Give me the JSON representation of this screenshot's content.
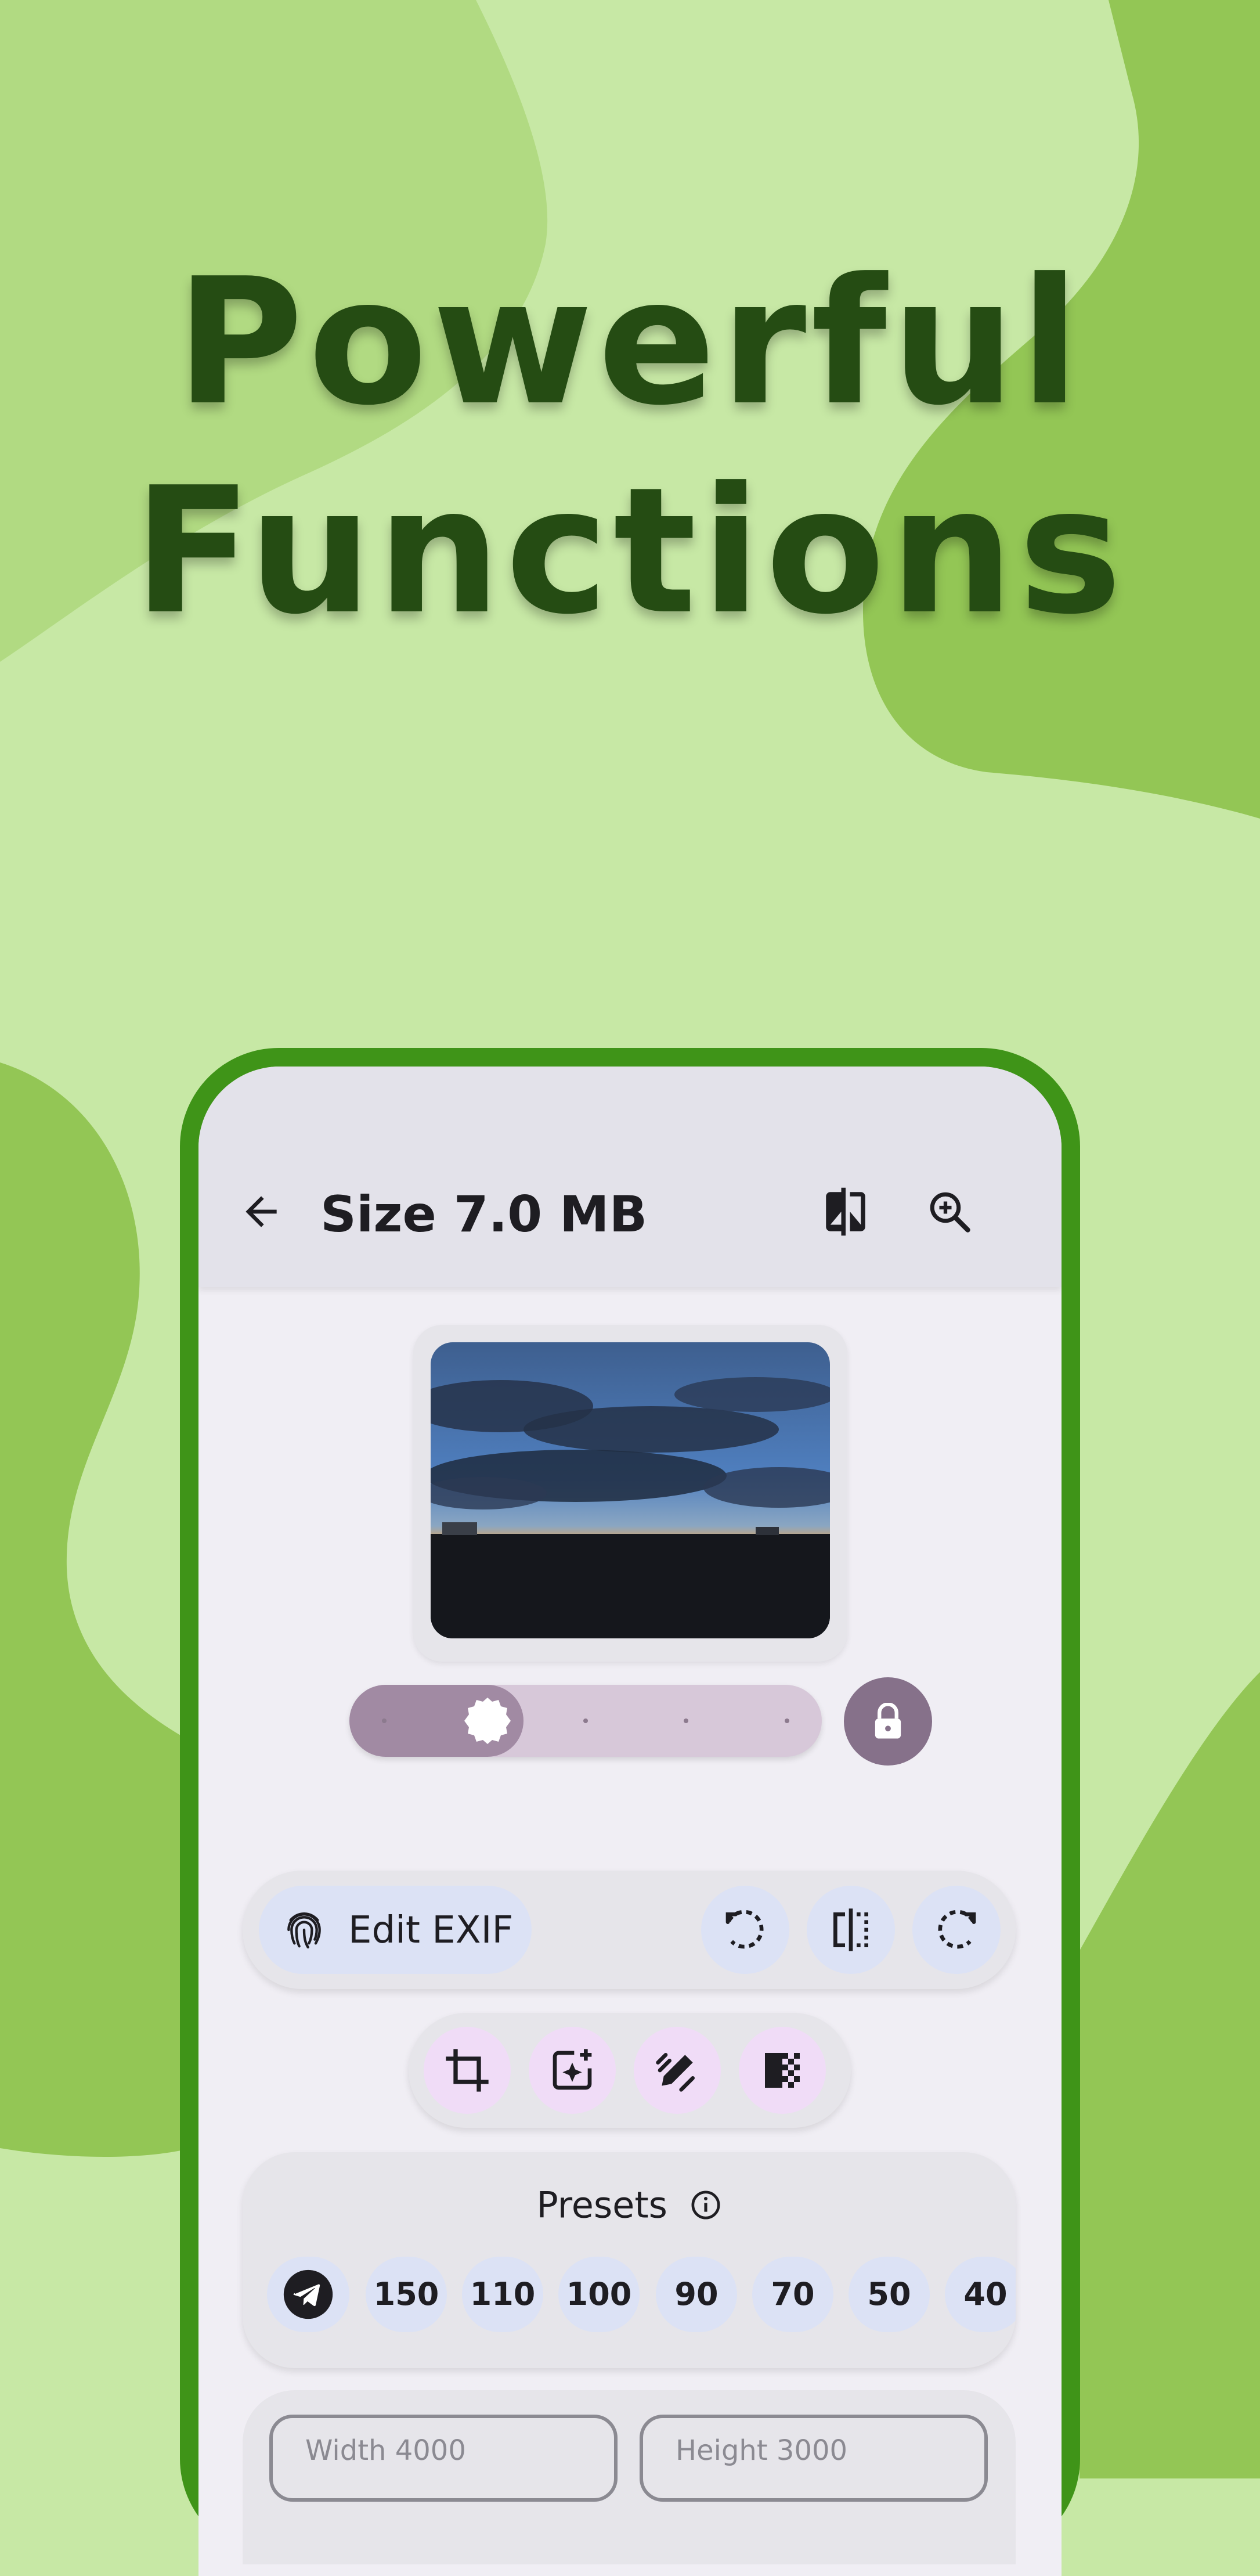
{
  "headline": {
    "line1": "Powerful",
    "line2": "Functions"
  },
  "app_bar": {
    "title": "Size 7.0 MB",
    "back_icon": "arrow-back-icon",
    "compare_icon": "compare-icon",
    "zoom_icon": "zoom-in-icon"
  },
  "quality_slider": {
    "value_fraction": 0.2,
    "steps": 5,
    "lock_icon": "lock-icon"
  },
  "actions": {
    "edit_exif_label": "Edit EXIF",
    "edit_exif_icon": "fingerprint-icon",
    "buttons": [
      "rotate-left-icon",
      "flip-icon",
      "rotate-right-icon"
    ],
    "tools": [
      "crop-icon",
      "add-photo-sparkle-icon",
      "draw-icon",
      "transparency-icon"
    ]
  },
  "presets": {
    "title": "Presets",
    "info_icon": "info-icon",
    "telegram_icon": "telegram-icon",
    "values": [
      "150",
      "110",
      "100",
      "90",
      "70",
      "50",
      "40"
    ]
  },
  "dimensions": {
    "width_label": "Width 4000",
    "height_label": "Height 3000"
  },
  "colors": {
    "background": "#c7e8a5",
    "blob_dark": "#93c655",
    "headline": "#254c13",
    "phone_frame": "#3f9418"
  }
}
